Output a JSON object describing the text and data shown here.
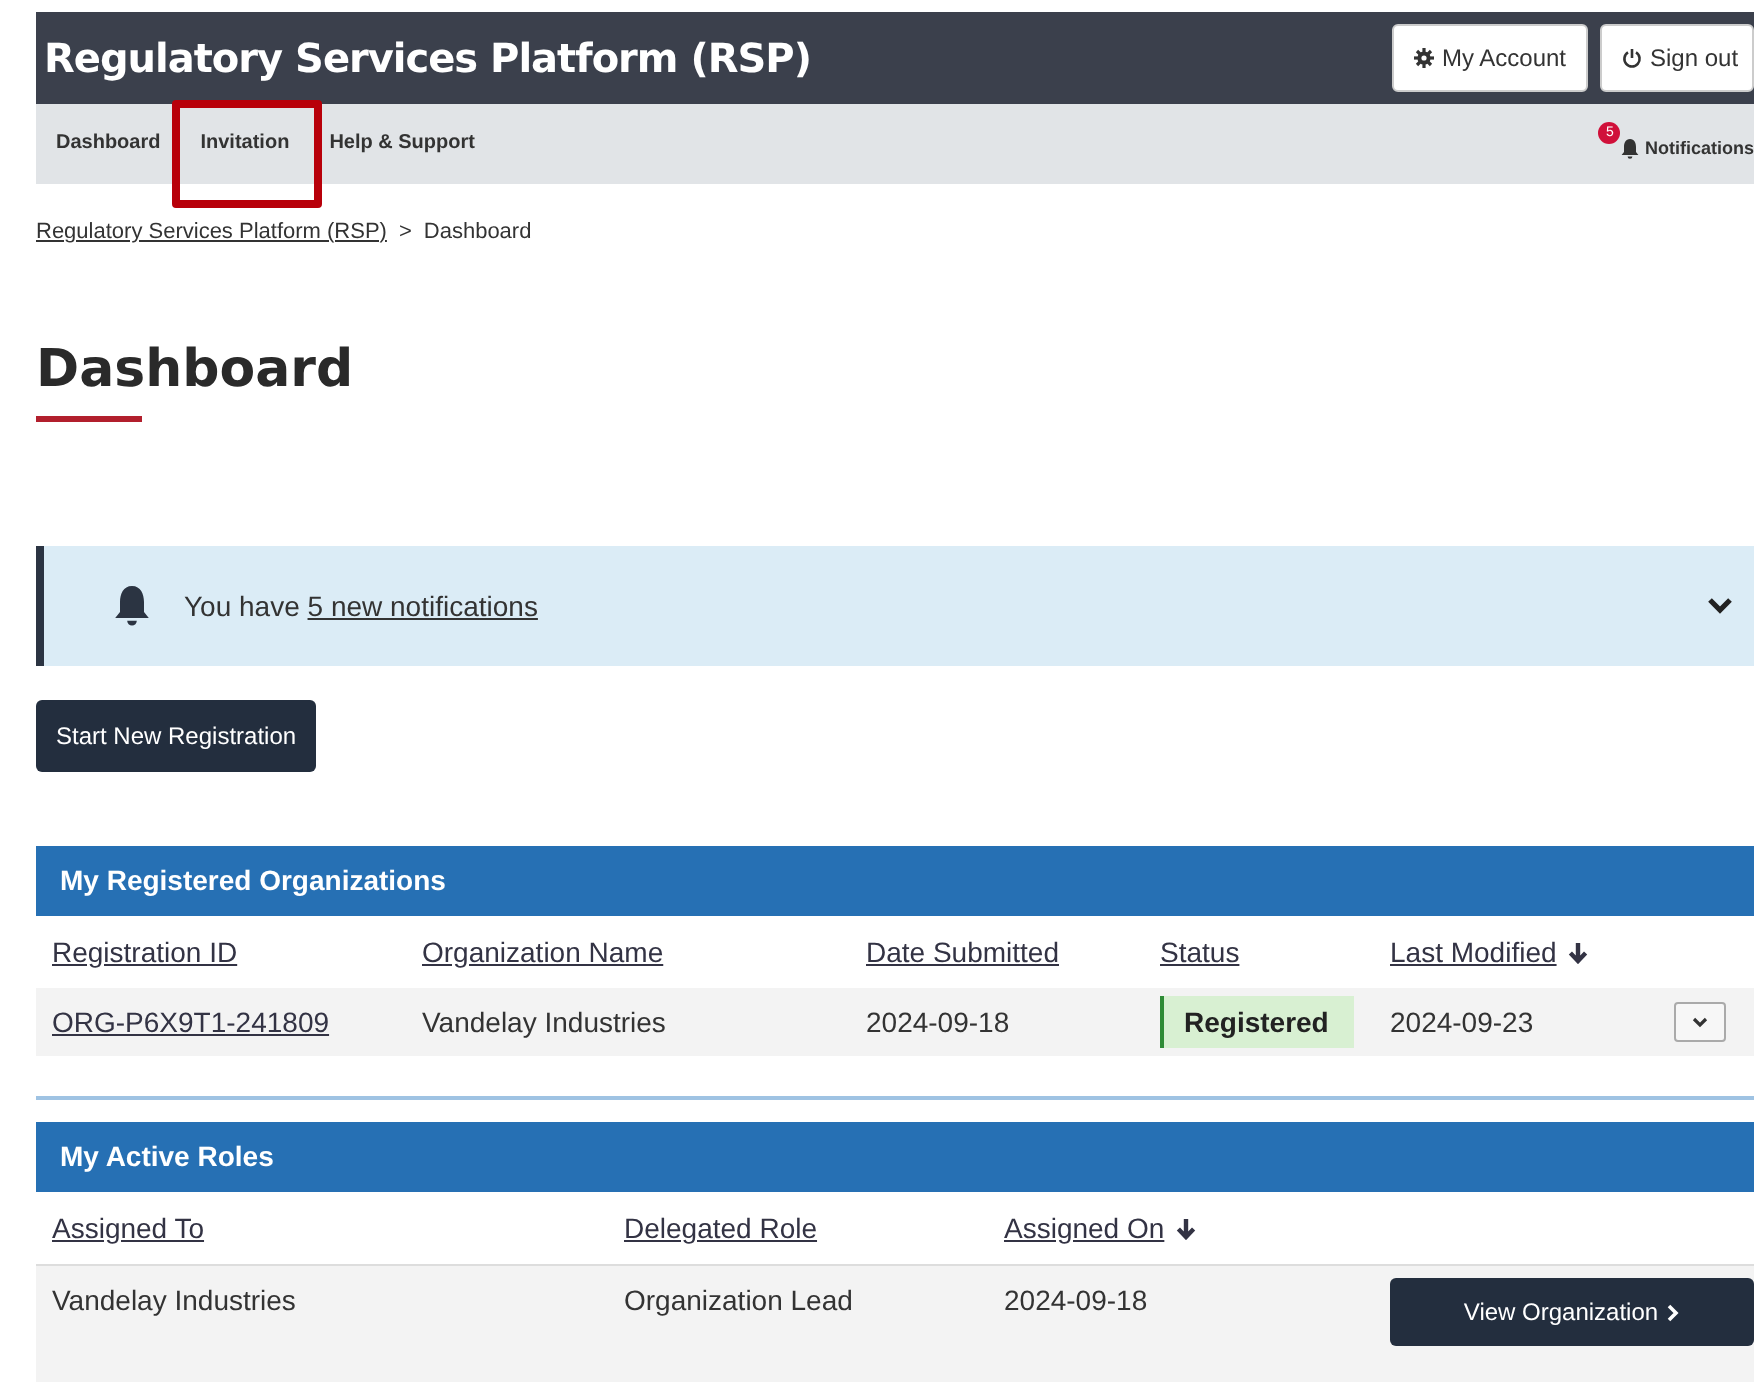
{
  "header": {
    "title": "Regulatory Services Platform (RSP)",
    "buttons": [
      {
        "kind": "account",
        "label": "My Account"
      },
      {
        "kind": "signout",
        "label": "Sign out"
      }
    ]
  },
  "nav": {
    "items": [
      {
        "label": "Dashboard",
        "selected": false,
        "highlighted": false
      },
      {
        "label": "Invitation",
        "selected": false,
        "highlighted": true
      },
      {
        "label": "Help & Support",
        "selected": false,
        "highlighted": false
      }
    ],
    "notifications": {
      "label": "Notifications",
      "badge": "5"
    }
  },
  "breadcrumb": [
    {
      "label": "Regulatory Services Platform (RSP)",
      "kind": "link"
    },
    {
      "label": ">",
      "kind": "separator"
    },
    {
      "label": "Dashboard",
      "kind": "current"
    }
  ],
  "page_title": "Dashboard",
  "alert": {
    "prefix": "You have",
    "link": "5 new notifications",
    "expanded": false
  },
  "primary_button": "Start New Registration",
  "organizations": {
    "title": "My Registered Organizations",
    "columns": [
      {
        "label": "Registration ID",
        "sorted": false
      },
      {
        "label": "Organization Name",
        "sorted": false
      },
      {
        "label": "Date Submitted",
        "sorted": false
      },
      {
        "label": "Status",
        "sorted": false
      },
      {
        "label": "Last Modified",
        "sorted": true
      }
    ],
    "rows": [
      {
        "id": "ORG-P6X9T1-241809",
        "name": "Vandelay Industries",
        "submitted": "2024-09-18",
        "status": "Registered",
        "modified": "2024-09-23",
        "expanded": false
      }
    ]
  },
  "roles": {
    "title": "My Active Roles",
    "columns": [
      {
        "label": "Assigned To",
        "sorted": false
      },
      {
        "label": "Delegated Role",
        "sorted": false
      },
      {
        "label": "Assigned On",
        "sorted": true
      }
    ],
    "rows": [
      {
        "assigned_to": "Vandelay Industries",
        "role": "Organization Lead",
        "assigned_on": "2024-09-18",
        "action": "View Organization"
      }
    ]
  }
}
